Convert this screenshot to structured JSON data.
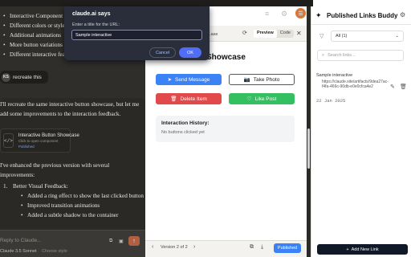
{
  "chat": {
    "top_bullets": [
      "Interactive Component Creation",
      "Different colors or styles",
      "Additional animations",
      "More button variations",
      "Different interactive features"
    ],
    "user_avatar": "KS",
    "user_message": "recreate this",
    "reply_intro": "I'll recreate the same interactive button showcase, but let me add some improvements to the interaction feedback.",
    "artifact": {
      "icon": "</>",
      "title": "Interactive Button Showcase",
      "subtitle": "Click to open component",
      "badge": "Published"
    },
    "reply_enhanced": "I've enhanced the previous version with several improvements:",
    "list_heading_num": "1.",
    "list_heading": "Better Visual Feedback:",
    "sub_bullets": [
      "Added a ring effect to show the last clicked button",
      "Improved transition animations",
      "Added a subtle shadow to the container"
    ],
    "input_placeholder": "Reply to Claude...",
    "model": "Claude 3.5 Sonnet",
    "style_select": "Choose style"
  },
  "preview": {
    "title_fragment": "...ase",
    "tabs": [
      "Preview",
      "Code"
    ],
    "heading": "Button Showcase",
    "buttons": {
      "send": "Send Message",
      "photo": "Take Photo",
      "delete": "Delete Item",
      "like": "Like Post"
    },
    "history_title": "Interaction History:",
    "history_empty": "No buttons clicked yet",
    "version": "Version 2 of 2",
    "publish": "Published"
  },
  "extension": {
    "title": "Published Links Buddy",
    "filter": "All (1)",
    "search_placeholder": "Search links...",
    "link": {
      "name": "Sample interactive",
      "url": "https://claude.site/artifacts/9dea27ac-f4fa-466c-90db-e0e0cfca4e2",
      "date": "22 Jan 2025"
    },
    "add_button": "Add New Link"
  },
  "dialog": {
    "title": "claude.ai says",
    "label": "Enter a title for the URL:",
    "value": "Sample interactive",
    "cancel": "Cancel",
    "ok": "OK"
  },
  "colors": {
    "accent_blue": "#3b82f6",
    "delete_red": "#e04a4a",
    "like_green": "#34c061",
    "claude_orange": "#d9773b"
  }
}
